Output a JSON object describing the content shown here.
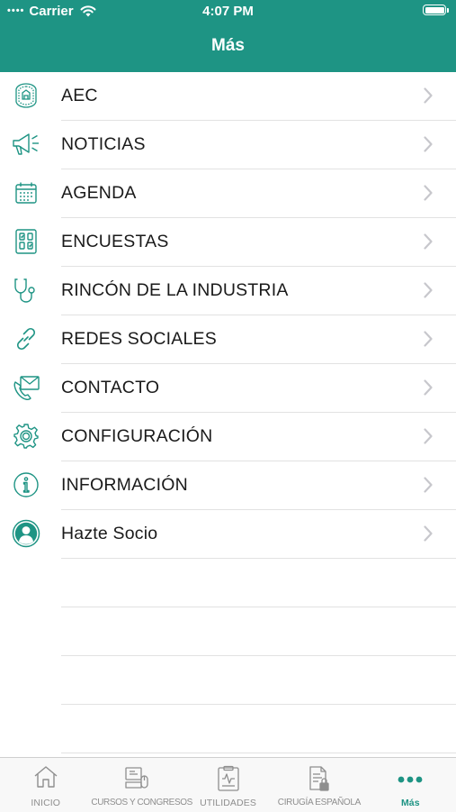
{
  "status_bar": {
    "carrier": "Carrier",
    "signal": "••••",
    "time": "4:07 PM"
  },
  "nav": {
    "title": "Más"
  },
  "menu": {
    "items": [
      {
        "label": "AEC",
        "icon": "aec-seal-icon"
      },
      {
        "label": "NOTICIAS",
        "icon": "megaphone-icon"
      },
      {
        "label": "AGENDA",
        "icon": "calendar-icon"
      },
      {
        "label": "ENCUESTAS",
        "icon": "survey-icon"
      },
      {
        "label": "RINCÓN DE LA INDUSTRIA",
        "icon": "stethoscope-icon"
      },
      {
        "label": "REDES SOCIALES",
        "icon": "link-icon"
      },
      {
        "label": "CONTACTO",
        "icon": "envelope-phone-icon"
      },
      {
        "label": "CONFIGURACIÓN",
        "icon": "gear-icon"
      },
      {
        "label": "INFORMACIÓN",
        "icon": "info-icon"
      },
      {
        "label": "Hazte Socio",
        "icon": "user-icon"
      }
    ]
  },
  "tabbar": {
    "tabs": [
      {
        "label": "INICIO",
        "icon": "home-icon"
      },
      {
        "label": "CURSOS Y CONGRESOS",
        "icon": "courses-icon"
      },
      {
        "label": "UTILIDADES",
        "icon": "clipboard-icon"
      },
      {
        "label": "CIRUGÍA ESPAÑOLA",
        "icon": "document-lock-icon"
      },
      {
        "label": "Más",
        "icon": "more-dots-icon",
        "active": true
      }
    ]
  },
  "colors": {
    "accent": "#1e9484",
    "tab_inactive": "#8e8e8e",
    "separator": "#e2e2e2",
    "chevron": "#c7c7cc"
  }
}
